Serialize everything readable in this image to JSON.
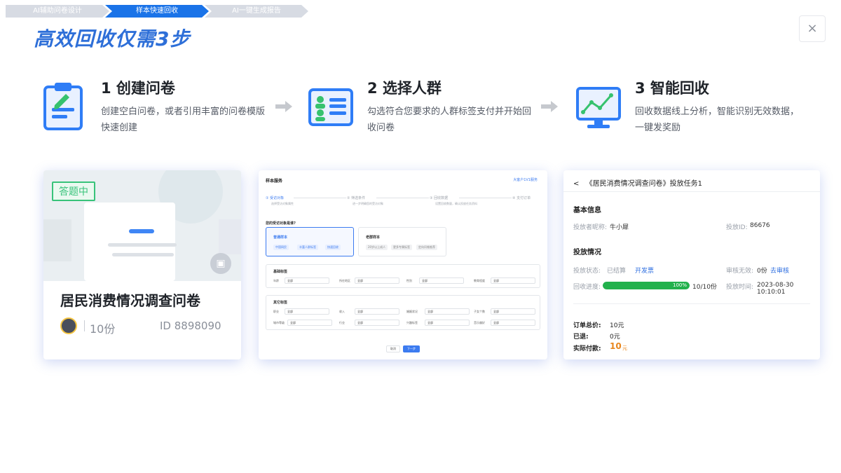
{
  "breadcrumb": [
    "AI辅助问卷设计",
    "样本快速回收",
    "AI一键生成报告"
  ],
  "title": "高效回收仅需3步",
  "close_label": "×",
  "steps": [
    {
      "title": "1 创建问卷",
      "desc": "创建空白问卷，或者引用丰富的问卷模版快速创建",
      "icon": "clipboard-edit-icon"
    },
    {
      "title": "2 选择人群",
      "desc": "勾选符合您要求的人群标签支付并开始回收问卷",
      "icon": "people-list-icon"
    },
    {
      "title": "3 智能回收",
      "desc": "回收数据线上分析，智能识别无效数据，一键发奖励",
      "icon": "monitor-chart-icon"
    }
  ],
  "survey_card": {
    "tag": "答题中",
    "name": "居民消费情况调查问卷",
    "count": "10份",
    "id": "ID 8898090"
  },
  "sample_form": {
    "title": "样本服务",
    "top_link": "大客户1V1服务",
    "steps": [
      "① 受访对象",
      "② 筛选条件",
      "③ 回收数据",
      "④ 支付订单"
    ],
    "step_subs": [
      "选择受访对象属性",
      "进一步明确您的受访对象",
      "设置回收数量，确认投放任务资料"
    ],
    "question": "您的受访对象是谁?",
    "options": [
      {
        "title": "普通样本",
        "chips": [
          "中国网民",
          "丰富人群标签",
          "快速回收"
        ]
      },
      {
        "title": "老群样本",
        "chips": [
          "20岁以上成人",
          "更多专属标签",
          "定向问卷推荐"
        ]
      }
    ],
    "group1": {
      "title": "基础标签",
      "fields": [
        {
          "label": "年龄",
          "value": "全部"
        },
        {
          "label": "所在地区",
          "value": "全部"
        },
        {
          "label": "性别",
          "value": "全部"
        },
        {
          "label": "教育程度",
          "value": "全部"
        }
      ]
    },
    "group2": {
      "title": "其它标签",
      "fields": [
        {
          "label": "职业",
          "value": "全部"
        },
        {
          "label": "收入",
          "value": "全部"
        },
        {
          "label": "婚姻状况",
          "value": "全部"
        },
        {
          "label": "子女个数",
          "value": "全部"
        },
        {
          "label": "城市等级",
          "value": "全部"
        },
        {
          "label": "行业",
          "value": "全部"
        },
        {
          "label": "兴趣标签",
          "value": "全部"
        },
        {
          "label": "音乐偏好",
          "value": "全部"
        }
      ]
    },
    "cancel": "取消",
    "next": "下一步"
  },
  "task_card": {
    "back": "<",
    "title": "《居民消费情况调查问卷》投放任务1",
    "basic_title": "基本信息",
    "publisher_label": "投放者昵称:",
    "publisher": "牛小犀",
    "pid_label": "投放ID:",
    "pid": "86676",
    "status_title": "投放情况",
    "state_label": "投放状态:",
    "state": "已结算",
    "invoice": "开发票",
    "audit_label": "审核无效:",
    "audit_value": "0份",
    "audit_link": "去审核",
    "progress_label": "回收进度:",
    "progress": 1.0,
    "progress_text": "100%",
    "progress_count": "10/10份",
    "time_label": "投放时间:",
    "time": "2023-08-30 10:10:01",
    "total_label": "订单总价:",
    "total": "10元",
    "refund_label": "已退:",
    "refund": "0元",
    "paid_label": "实际付款:",
    "paid": "10",
    "paid_unit": "元"
  }
}
